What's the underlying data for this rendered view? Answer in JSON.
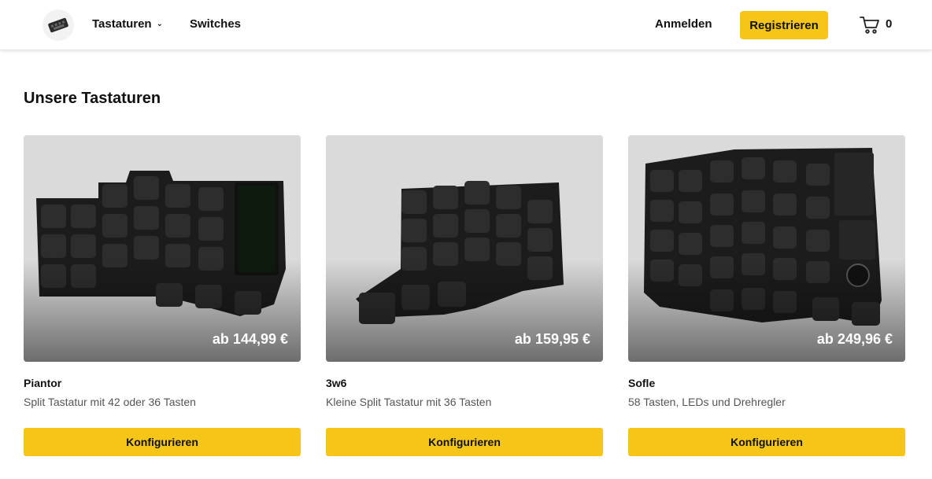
{
  "header": {
    "logo_icon": "keyboard-logo-icon",
    "nav": {
      "keyboards_label": "Tastaturen",
      "switches_label": "Switches"
    },
    "login_label": "Anmelden",
    "register_label": "Registrieren",
    "cart_icon": "shopping-cart-icon",
    "cart_count": "0"
  },
  "main": {
    "title": "Unsere Tastaturen",
    "products": [
      {
        "name": "Piantor",
        "description": "Split Tastatur mit 42 oder 36 Tasten",
        "price": "ab 144,99 €",
        "button_label": "Konfigurieren"
      },
      {
        "name": "3w6",
        "description": "Kleine Split Tastatur mit 36 Tasten",
        "price": "ab 159,95 €",
        "button_label": "Konfigurieren"
      },
      {
        "name": "Sofle",
        "description": "58 Tasten, LEDs und Drehregler",
        "price": "ab 249,96 €",
        "button_label": "Konfigurieren"
      }
    ]
  },
  "colors": {
    "accent": "#f5c518",
    "keyboard_body": "#1e1e1e",
    "keycap": "#2b2b2b",
    "photo_background": "#d9d9d9"
  }
}
